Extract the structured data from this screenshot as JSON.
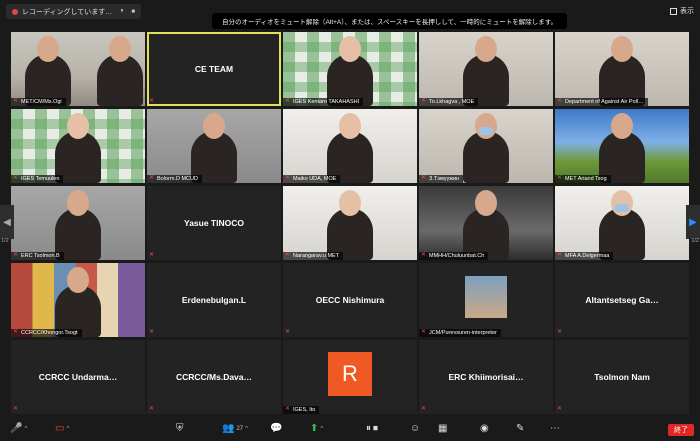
{
  "topbar": {
    "recording_label": "レコーディングしています…",
    "pause_glyph": "⏸",
    "stop_glyph": "■",
    "notice": "自分のオーディオをミュート解除（Alt+A）、または、スペースキーを長押しして、一時的にミュートを解除します。",
    "view_label": "表示"
  },
  "tiles": [
    {
      "name": "MET/CM/Ms.Ogi",
      "center": "",
      "kind": "office"
    },
    {
      "name": "",
      "center": "CE TEAM",
      "kind": "text",
      "active": true
    },
    {
      "name": "IGES Kentaro TAKAHASHI",
      "center": "",
      "kind": "green"
    },
    {
      "name": "To.Lkhagva , MOE",
      "center": "",
      "kind": "wall"
    },
    {
      "name": "Department of Against Air Poll…",
      "center": "",
      "kind": "wall"
    },
    {
      "name": "IGES Temuulen",
      "center": "",
      "kind": "green"
    },
    {
      "name": "Bolorm.D MCUD",
      "center": "",
      "kind": "gray"
    },
    {
      "name": "Maiko UDA, MOE",
      "center": "",
      "kind": "light"
    },
    {
      "name": "З.Тэмүүжин",
      "center": "",
      "kind": "wall"
    },
    {
      "name": "MET Ariand Tsog",
      "center": "",
      "kind": "sky"
    },
    {
      "name": "ERC Tsolmon.B",
      "center": "",
      "kind": "gray"
    },
    {
      "name": "",
      "center": "Yasue TINOCO",
      "kind": "text"
    },
    {
      "name": "Narangarav.u MET",
      "center": "",
      "kind": "light"
    },
    {
      "name": "MMHH/Chuluunbat.Ch",
      "center": "",
      "kind": "car"
    },
    {
      "name": "MFA A.Delgermaa",
      "center": "",
      "kind": "light"
    },
    {
      "name": "CCRCC/Khongor.Tsogt",
      "center": "",
      "kind": "houses"
    },
    {
      "name": "",
      "center": "Erdenebulgan.L",
      "kind": "text"
    },
    {
      "name": "",
      "center": "OECC Nishimura",
      "kind": "text"
    },
    {
      "name": "JCM/Purevsuren-interpreter",
      "center": "",
      "kind": "photo"
    },
    {
      "name": "",
      "center": "Altantsetseg Ga…",
      "kind": "text"
    },
    {
      "name": "",
      "center": "CCRCC Undarma…",
      "kind": "text"
    },
    {
      "name": "",
      "center": "CCRCC/Ms.Dava…",
      "kind": "text"
    },
    {
      "name": "IGES, Ito",
      "center": "",
      "kind": "avatar",
      "avatar_letter": "R"
    },
    {
      "name": "",
      "center": "ERC Khiimorisai…",
      "kind": "text"
    },
    {
      "name": "",
      "center": "Tsolmon Nam",
      "kind": "text"
    }
  ],
  "pager": {
    "left": "1/2",
    "right": "1/2"
  },
  "toolbar": {
    "participants_count": "27",
    "end_label": "終了"
  },
  "colors": {
    "accent": "#2d8cff",
    "active_border": "#e1e25a",
    "end_red": "#e02828",
    "avatar_orange": "#ef5a24"
  }
}
